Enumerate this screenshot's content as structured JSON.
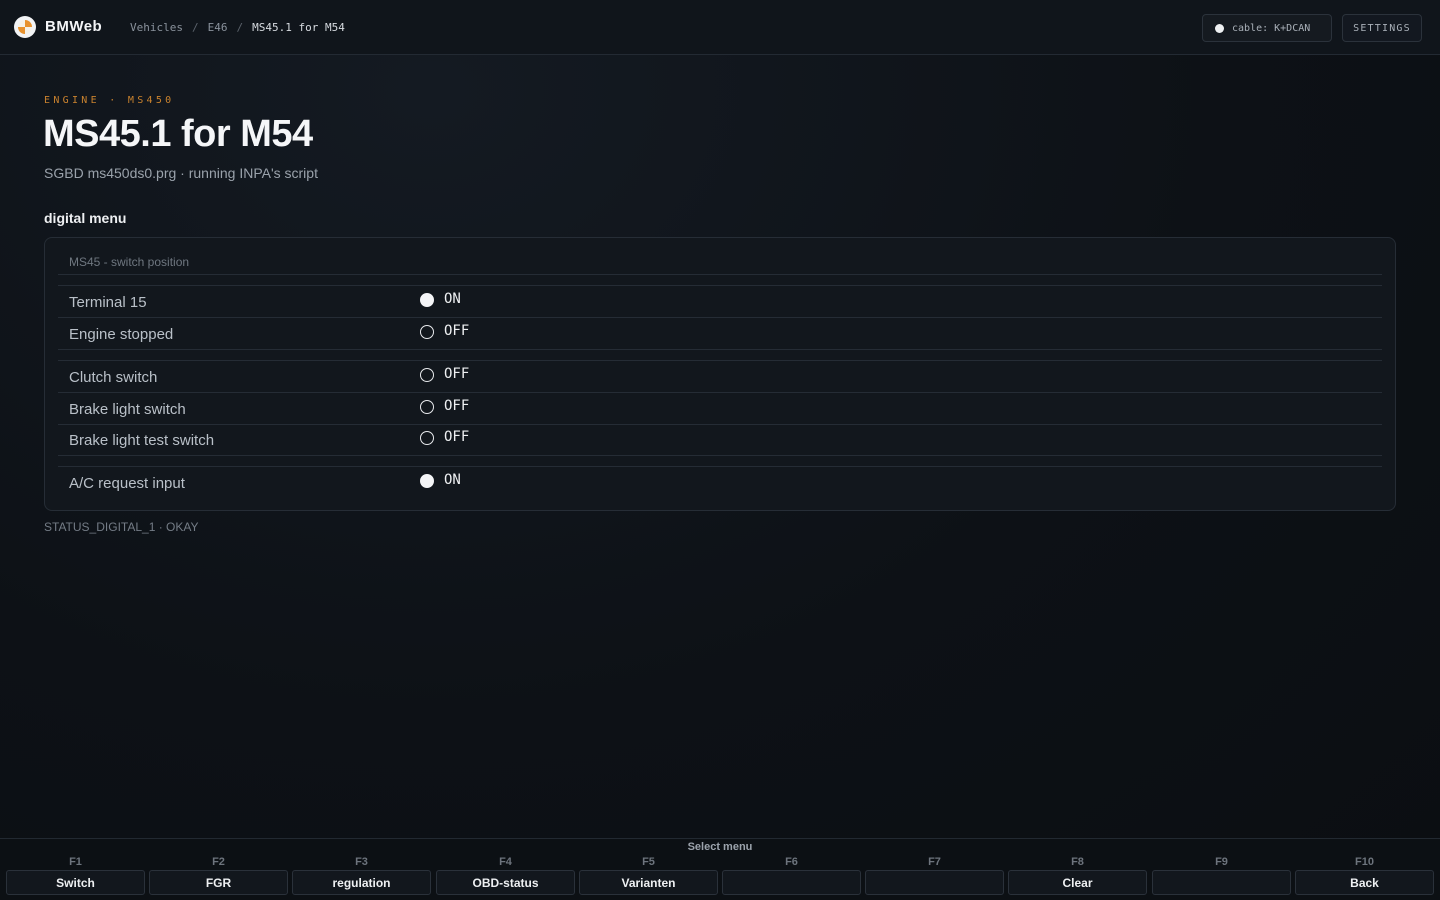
{
  "header": {
    "brand": "BMWeb",
    "breadcrumb": [
      "Vehicles",
      "E46",
      "MS45.1 for M54"
    ],
    "cable_label": "cable: K+DCAN",
    "settings_label": "SETTINGS"
  },
  "page": {
    "eyebrow": "ENGINE · MS450",
    "title": "MS45.1 for M54",
    "subtitle": "SGBD ms450ds0.prg · running INPA's script",
    "section_title": "digital menu"
  },
  "panel": {
    "caption": "MS45 - switch position",
    "rows": [
      {
        "label": "Terminal 15",
        "state": "on",
        "value": "ON"
      },
      {
        "label": "Engine stopped",
        "state": "off",
        "value": "OFF"
      },
      {
        "label": "Clutch switch",
        "state": "off",
        "value": "OFF"
      },
      {
        "label": "Brake light switch",
        "state": "off",
        "value": "OFF"
      },
      {
        "label": "Brake light test switch",
        "state": "off",
        "value": "OFF"
      },
      {
        "label": "A/C request input",
        "state": "on",
        "value": "ON"
      }
    ]
  },
  "status_line": "STATUS_DIGITAL_1 · OKAY",
  "fkeys": {
    "title": "Select menu",
    "keys": [
      {
        "key": "F1",
        "label": "Switch"
      },
      {
        "key": "F2",
        "label": "FGR"
      },
      {
        "key": "F3",
        "label": "regulation"
      },
      {
        "key": "F4",
        "label": "OBD-status"
      },
      {
        "key": "F5",
        "label": "Varianten"
      },
      {
        "key": "F6",
        "label": ""
      },
      {
        "key": "F7",
        "label": ""
      },
      {
        "key": "F8",
        "label": "Clear"
      },
      {
        "key": "F9",
        "label": ""
      },
      {
        "key": "F10",
        "label": "Back"
      }
    ]
  },
  "colors": {
    "accent": "#c9822e",
    "background": "#0d1015",
    "panel": "#12171d",
    "indicator_on": "#f4f5f7"
  }
}
